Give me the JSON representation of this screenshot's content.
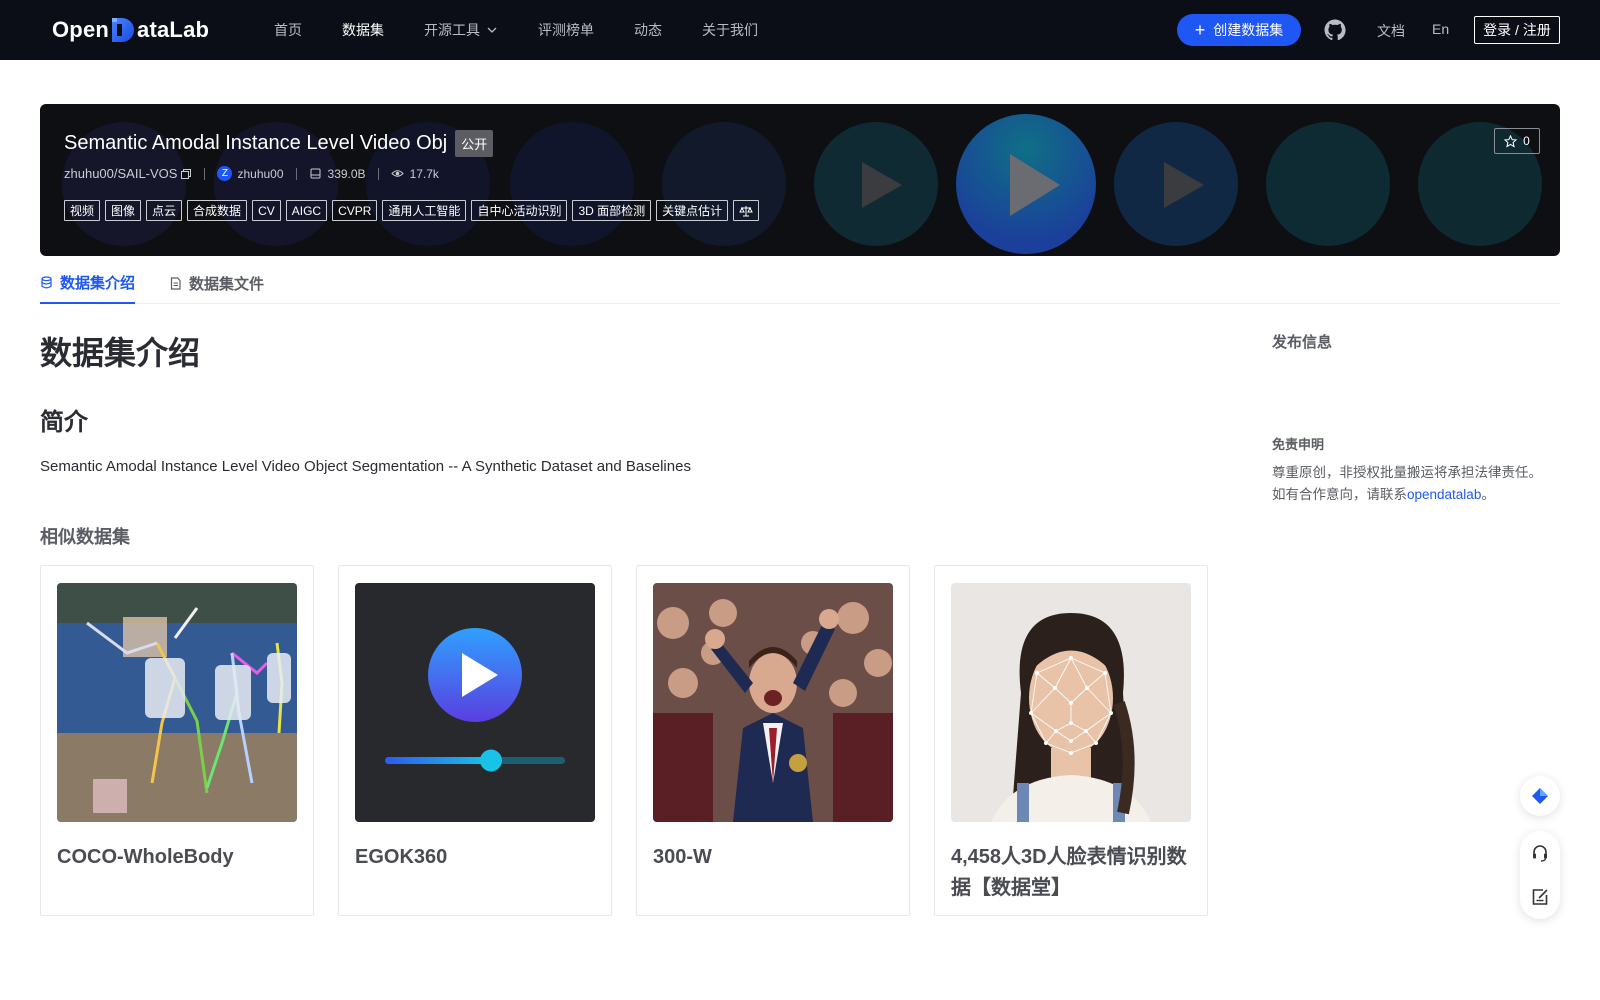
{
  "nav": {
    "logo_open": "Open",
    "logo_d": "D",
    "logo_rest": "ataLab",
    "links": [
      {
        "label": "首页"
      },
      {
        "label": "数据集"
      },
      {
        "label": "开源工具"
      },
      {
        "label": "评测榜单"
      },
      {
        "label": "动态"
      },
      {
        "label": "关于我们"
      }
    ],
    "create_label": "创建数据集",
    "create_plus": "+",
    "docs_label": "文档",
    "lang_label": "En",
    "login_label": "登录 / 注册"
  },
  "banner": {
    "title": "Semantic Amodal Instance Level Video Obj",
    "visibility": "公开",
    "repo": "zhuhu00/SAIL-VOS",
    "avatar_letter": "Z",
    "user": "zhuhu00",
    "size": "339.0B",
    "views": "17.7k",
    "tags": [
      "视频",
      "图像",
      "点云",
      "合成数据",
      "CV",
      "AIGC",
      "CVPR",
      "通用人工智能",
      "自中心活动识别",
      "3D 面部检测",
      "关键点估计"
    ],
    "star_count": "0"
  },
  "tabs": [
    {
      "label": "数据集介绍",
      "icon": "database-icon"
    },
    {
      "label": "数据集文件",
      "icon": "file-icon"
    }
  ],
  "main": {
    "heading": "数据集介绍",
    "section_title": "简介",
    "description": "Semantic Amodal Instance Level Video Object Segmentation -- A Synthetic Dataset and Baselines",
    "similar_title": "相似数据集",
    "cards": [
      {
        "title": "COCO-WholeBody",
        "image": "baseball-pose-keypoints"
      },
      {
        "title": "EGOK360",
        "image": "video-play-placeholder"
      },
      {
        "title": "300-W",
        "image": "cheering-crowd-photo"
      },
      {
        "title": "4,458人3D人脸表情识别数据【数据堂】",
        "image": "face-landmark-mesh-photo"
      }
    ]
  },
  "sidebar": {
    "publish_title": "发布信息",
    "disclaimer_title": "免责申明",
    "disclaimer_line1": "尊重原创，非授权批量搬运将承担法律责任。",
    "disclaimer_line2_prefix": "如有合作意向，请联系",
    "disclaimer_link": "opendatalab",
    "disclaimer_line2_suffix": "。"
  },
  "colors": {
    "nav_bg": "#0b0e17",
    "brand_blue": "#1f57f5",
    "banner_bg": "#0e0f12"
  }
}
